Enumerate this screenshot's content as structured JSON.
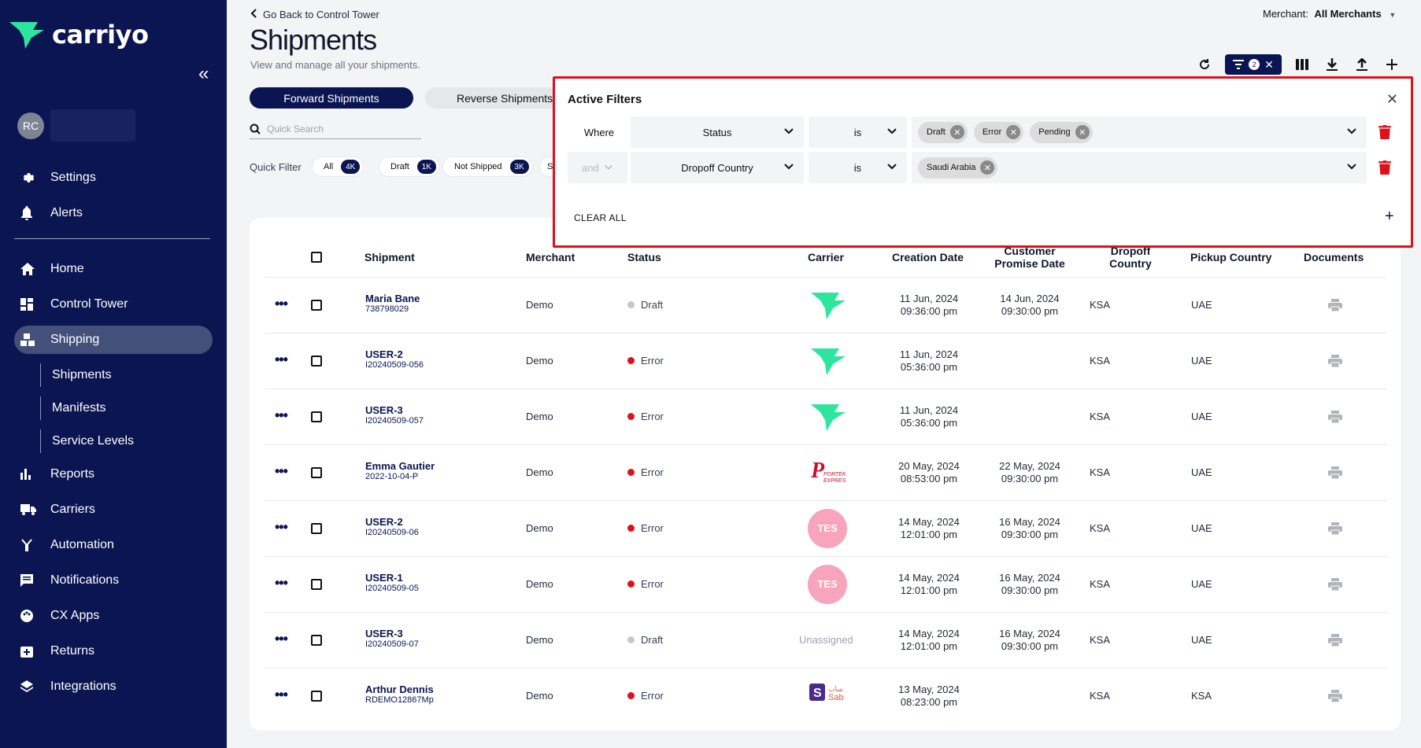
{
  "app": {
    "brand": "carriyo"
  },
  "sidebar": {
    "avatar_initials": "RC",
    "items_top": [
      {
        "label": "Settings",
        "icon": "gear-icon"
      },
      {
        "label": "Alerts",
        "icon": "bell-icon"
      }
    ],
    "items": [
      {
        "label": "Home",
        "icon": "home-icon"
      },
      {
        "label": "Control Tower",
        "icon": "dashboard-icon"
      },
      {
        "label": "Shipping",
        "icon": "shipping-icon"
      },
      {
        "label": "Reports",
        "icon": "bar-chart-icon"
      },
      {
        "label": "Carriers",
        "icon": "truck-icon"
      },
      {
        "label": "Automation",
        "icon": "automation-icon"
      },
      {
        "label": "Notifications",
        "icon": "message-icon"
      },
      {
        "label": "CX Apps",
        "icon": "palette-icon"
      },
      {
        "label": "Returns",
        "icon": "return-box-icon"
      },
      {
        "label": "Integrations",
        "icon": "layers-icon"
      }
    ],
    "sub_items": [
      {
        "label": "Shipments"
      },
      {
        "label": "Manifests"
      },
      {
        "label": "Service Levels"
      }
    ]
  },
  "header": {
    "back_label": "Go Back to Control Tower",
    "title": "Shipments",
    "subtitle": "View and manage all your shipments.",
    "merchant_label": "Merchant:",
    "merchant_value": "All Merchants",
    "filter_count": "2"
  },
  "tabs": {
    "forward": "Forward Shipments",
    "reverse": "Reverse Shipments"
  },
  "search": {
    "placeholder": "Quick Search"
  },
  "quick_filter": {
    "label": "Quick Filter",
    "chips": [
      {
        "label": "All",
        "count": "4K"
      },
      {
        "label": "Draft",
        "count": "1K"
      },
      {
        "label": "Not Shipped",
        "count": "3K"
      },
      {
        "label": "S",
        "count": ""
      }
    ]
  },
  "table": {
    "columns": [
      "Shipment",
      "Merchant",
      "Status",
      "Carrier",
      "Creation Date",
      "Customer Promise Date",
      "Dropoff Country",
      "Pickup Country",
      "Documents"
    ],
    "rows": [
      {
        "name": "Maria Bane",
        "id": "738798029",
        "merchant": "Demo",
        "status": "Draft",
        "status_color": "#c8c8c8",
        "carrier": "carriyo",
        "created_date": "11 Jun, 2024",
        "created_time": "09:36:00 pm",
        "promise_date": "14 Jun, 2024",
        "promise_time": "09:30:00 pm",
        "dropoff": "KSA",
        "pickup": "UAE"
      },
      {
        "name": "USER-2",
        "id": "I20240509-056",
        "merchant": "Demo",
        "status": "Error",
        "status_color": "#e0101a",
        "carrier": "carriyo",
        "created_date": "11 Jun, 2024",
        "created_time": "05:36:00 pm",
        "promise_date": "",
        "promise_time": "",
        "dropoff": "KSA",
        "pickup": "UAE"
      },
      {
        "name": "USER-3",
        "id": "I20240509-057",
        "merchant": "Demo",
        "status": "Error",
        "status_color": "#e0101a",
        "carrier": "carriyo",
        "created_date": "11 Jun, 2024",
        "created_time": "05:36:00 pm",
        "promise_date": "",
        "promise_time": "",
        "dropoff": "KSA",
        "pickup": "UAE"
      },
      {
        "name": "Emma Gautier",
        "id": "2022-10-04-P",
        "merchant": "Demo",
        "status": "Error",
        "status_color": "#e0101a",
        "carrier": "porter",
        "created_date": "20 May, 2024",
        "created_time": "08:53:00 pm",
        "promise_date": "22 May, 2024",
        "promise_time": "09:30:00 pm",
        "dropoff": "KSA",
        "pickup": "UAE"
      },
      {
        "name": "USER-2",
        "id": "I20240509-06",
        "merchant": "Demo",
        "status": "Error",
        "status_color": "#e0101a",
        "carrier": "TES",
        "created_date": "14 May, 2024",
        "created_time": "12:01:00 pm",
        "promise_date": "16 May, 2024",
        "promise_time": "09:30:00 pm",
        "dropoff": "KSA",
        "pickup": "UAE"
      },
      {
        "name": "USER-1",
        "id": "I20240509-05",
        "merchant": "Demo",
        "status": "Error",
        "status_color": "#e0101a",
        "carrier": "TES",
        "created_date": "14 May, 2024",
        "created_time": "12:01:00 pm",
        "promise_date": "16 May, 2024",
        "promise_time": "09:30:00 pm",
        "dropoff": "KSA",
        "pickup": "UAE"
      },
      {
        "name": "USER-3",
        "id": "I20240509-07",
        "merchant": "Demo",
        "status": "Draft",
        "status_color": "#c8c8c8",
        "carrier": "Unassigned",
        "created_date": "14 May, 2024",
        "created_time": "12:01:00 pm",
        "promise_date": "16 May, 2024",
        "promise_time": "09:30:00 pm",
        "dropoff": "KSA",
        "pickup": "UAE"
      },
      {
        "name": "Arthur Dennis",
        "id": "RDEMO12867Mp",
        "merchant": "Demo",
        "status": "Error",
        "status_color": "#e0101a",
        "carrier": "sab",
        "created_date": "13 May, 2024",
        "created_time": "08:23:00 pm",
        "promise_date": "",
        "promise_time": "",
        "dropoff": "KSA",
        "pickup": "KSA"
      }
    ]
  },
  "filters": {
    "title": "Active Filters",
    "where_label": "Where",
    "and_label": "and",
    "clear_label": "CLEAR ALL",
    "rows": [
      {
        "field": "Status",
        "op": "is",
        "values": [
          "Draft",
          "Error",
          "Pending"
        ]
      },
      {
        "field": "Dropoff Country",
        "op": "is",
        "values": [
          "Saudi Arabia"
        ]
      }
    ]
  },
  "colors": {
    "sidebar": "#0b1551",
    "accent": "#0b1551",
    "error": "#e0101a",
    "brand_green": "#2ee59d"
  }
}
